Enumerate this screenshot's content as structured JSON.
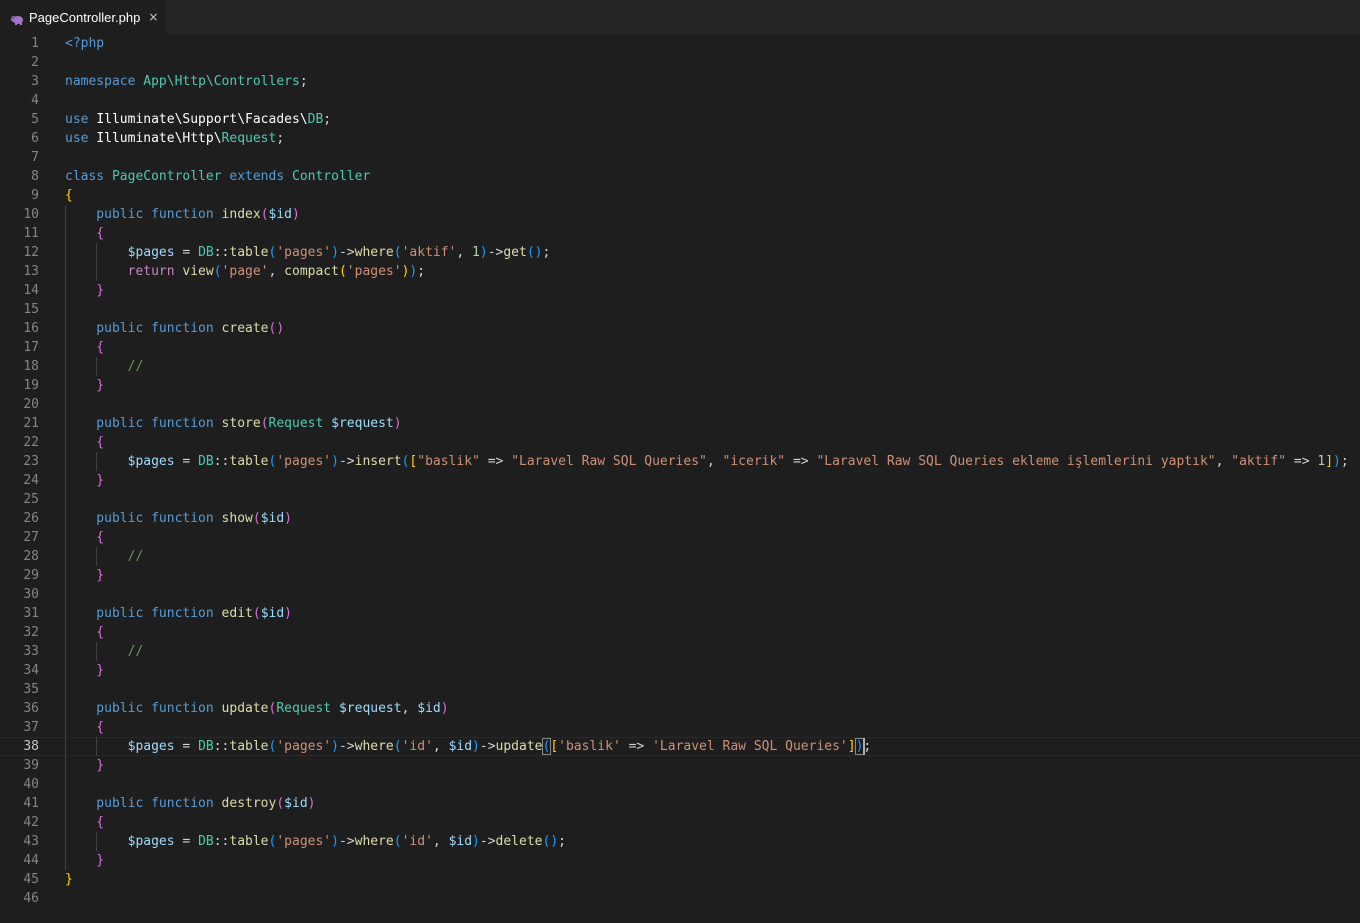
{
  "tab": {
    "title": "PageController.php",
    "close": "×",
    "icon": "php-elephant-icon"
  },
  "editor": {
    "active_line": 38,
    "lines": [
      {
        "n": "1",
        "tokens": [
          {
            "t": "<?php",
            "c": "kw"
          }
        ]
      },
      {
        "n": "2",
        "tokens": []
      },
      {
        "n": "3",
        "tokens": [
          {
            "t": "namespace ",
            "c": "kw"
          },
          {
            "t": "App\\Http\\Controllers",
            "c": "cls"
          },
          {
            "t": ";",
            "c": "txt"
          }
        ]
      },
      {
        "n": "4",
        "tokens": []
      },
      {
        "n": "5",
        "tokens": [
          {
            "t": "use ",
            "c": "kw"
          },
          {
            "t": "Illuminate\\Support\\Facades\\",
            "c": "pl"
          },
          {
            "t": "DB",
            "c": "cls"
          },
          {
            "t": ";",
            "c": "txt"
          }
        ]
      },
      {
        "n": "6",
        "tokens": [
          {
            "t": "use ",
            "c": "kw"
          },
          {
            "t": "Illuminate\\Http\\",
            "c": "pl"
          },
          {
            "t": "Request",
            "c": "cls"
          },
          {
            "t": ";",
            "c": "txt"
          }
        ]
      },
      {
        "n": "7",
        "tokens": []
      },
      {
        "n": "8",
        "tokens": [
          {
            "t": "class ",
            "c": "kw"
          },
          {
            "t": "PageController ",
            "c": "cls"
          },
          {
            "t": "extends ",
            "c": "kw"
          },
          {
            "t": "Controller",
            "c": "cls"
          }
        ]
      },
      {
        "n": "9",
        "tokens": [
          {
            "t": "{",
            "c": "b1"
          }
        ]
      },
      {
        "n": "10",
        "tokens": [
          {
            "t": "    public function ",
            "c": "kw"
          },
          {
            "t": "index",
            "c": "fn"
          },
          {
            "t": "(",
            "c": "b2"
          },
          {
            "t": "$id",
            "c": "var"
          },
          {
            "t": ")",
            "c": "b2"
          }
        ]
      },
      {
        "n": "11",
        "tokens": [
          {
            "t": "    {",
            "c": "b2"
          }
        ]
      },
      {
        "n": "12",
        "tokens": [
          {
            "t": "        $pages",
            "c": "var"
          },
          {
            "t": " = ",
            "c": "txt"
          },
          {
            "t": "DB",
            "c": "cls"
          },
          {
            "t": "::",
            "c": "txt"
          },
          {
            "t": "table",
            "c": "fn"
          },
          {
            "t": "(",
            "c": "b3"
          },
          {
            "t": "'pages'",
            "c": "str"
          },
          {
            "t": ")",
            "c": "b3"
          },
          {
            "t": "->",
            "c": "txt"
          },
          {
            "t": "where",
            "c": "fn"
          },
          {
            "t": "(",
            "c": "b3"
          },
          {
            "t": "'aktif'",
            "c": "str"
          },
          {
            "t": ", ",
            "c": "txt"
          },
          {
            "t": "1",
            "c": "num"
          },
          {
            "t": ")",
            "c": "b3"
          },
          {
            "t": "->",
            "c": "txt"
          },
          {
            "t": "get",
            "c": "fn"
          },
          {
            "t": "()",
            "c": "b3"
          },
          {
            "t": ";",
            "c": "txt"
          }
        ]
      },
      {
        "n": "13",
        "tokens": [
          {
            "t": "        return ",
            "c": "ctrl"
          },
          {
            "t": "view",
            "c": "fn"
          },
          {
            "t": "(",
            "c": "b3"
          },
          {
            "t": "'page'",
            "c": "str"
          },
          {
            "t": ", ",
            "c": "txt"
          },
          {
            "t": "compact",
            "c": "fn"
          },
          {
            "t": "(",
            "c": "b1"
          },
          {
            "t": "'pages'",
            "c": "str"
          },
          {
            "t": ")",
            "c": "b1"
          },
          {
            "t": ")",
            "c": "b3"
          },
          {
            "t": ";",
            "c": "txt"
          }
        ]
      },
      {
        "n": "14",
        "tokens": [
          {
            "t": "    }",
            "c": "b2"
          }
        ]
      },
      {
        "n": "15",
        "tokens": []
      },
      {
        "n": "16",
        "tokens": [
          {
            "t": "    public function ",
            "c": "kw"
          },
          {
            "t": "create",
            "c": "fn"
          },
          {
            "t": "()",
            "c": "b2"
          }
        ]
      },
      {
        "n": "17",
        "tokens": [
          {
            "t": "    {",
            "c": "b2"
          }
        ]
      },
      {
        "n": "18",
        "tokens": [
          {
            "t": "        //",
            "c": "cmt"
          }
        ]
      },
      {
        "n": "19",
        "tokens": [
          {
            "t": "    }",
            "c": "b2"
          }
        ]
      },
      {
        "n": "20",
        "tokens": []
      },
      {
        "n": "21",
        "tokens": [
          {
            "t": "    public function ",
            "c": "kw"
          },
          {
            "t": "store",
            "c": "fn"
          },
          {
            "t": "(",
            "c": "b2"
          },
          {
            "t": "Request ",
            "c": "cls"
          },
          {
            "t": "$request",
            "c": "var"
          },
          {
            "t": ")",
            "c": "b2"
          }
        ]
      },
      {
        "n": "22",
        "tokens": [
          {
            "t": "    {",
            "c": "b2"
          }
        ]
      },
      {
        "n": "23",
        "tokens": [
          {
            "t": "        $pages",
            "c": "var"
          },
          {
            "t": " = ",
            "c": "txt"
          },
          {
            "t": "DB",
            "c": "cls"
          },
          {
            "t": "::",
            "c": "txt"
          },
          {
            "t": "table",
            "c": "fn"
          },
          {
            "t": "(",
            "c": "b3"
          },
          {
            "t": "'pages'",
            "c": "str"
          },
          {
            "t": ")",
            "c": "b3"
          },
          {
            "t": "->",
            "c": "txt"
          },
          {
            "t": "insert",
            "c": "fn"
          },
          {
            "t": "(",
            "c": "b3"
          },
          {
            "t": "[",
            "c": "b1"
          },
          {
            "t": "\"baslik\"",
            "c": "str"
          },
          {
            "t": " => ",
            "c": "txt"
          },
          {
            "t": "\"Laravel Raw SQL Queries\"",
            "c": "str"
          },
          {
            "t": ", ",
            "c": "txt"
          },
          {
            "t": "\"icerik\"",
            "c": "str"
          },
          {
            "t": " => ",
            "c": "txt"
          },
          {
            "t": "\"Laravel Raw SQL Queries ekleme işlemlerini yaptık\"",
            "c": "str"
          },
          {
            "t": ", ",
            "c": "txt"
          },
          {
            "t": "\"aktif\"",
            "c": "str"
          },
          {
            "t": " => ",
            "c": "txt"
          },
          {
            "t": "1",
            "c": "num"
          },
          {
            "t": "]",
            "c": "b1"
          },
          {
            "t": ")",
            "c": "b3"
          },
          {
            "t": ";",
            "c": "txt"
          }
        ]
      },
      {
        "n": "24",
        "tokens": [
          {
            "t": "    }",
            "c": "b2"
          }
        ]
      },
      {
        "n": "25",
        "tokens": []
      },
      {
        "n": "26",
        "tokens": [
          {
            "t": "    public function ",
            "c": "kw"
          },
          {
            "t": "show",
            "c": "fn"
          },
          {
            "t": "(",
            "c": "b2"
          },
          {
            "t": "$id",
            "c": "var"
          },
          {
            "t": ")",
            "c": "b2"
          }
        ]
      },
      {
        "n": "27",
        "tokens": [
          {
            "t": "    {",
            "c": "b2"
          }
        ]
      },
      {
        "n": "28",
        "tokens": [
          {
            "t": "        //",
            "c": "cmt"
          }
        ]
      },
      {
        "n": "29",
        "tokens": [
          {
            "t": "    }",
            "c": "b2"
          }
        ]
      },
      {
        "n": "30",
        "tokens": []
      },
      {
        "n": "31",
        "tokens": [
          {
            "t": "    public function ",
            "c": "kw"
          },
          {
            "t": "edit",
            "c": "fn"
          },
          {
            "t": "(",
            "c": "b2"
          },
          {
            "t": "$id",
            "c": "var"
          },
          {
            "t": ")",
            "c": "b2"
          }
        ]
      },
      {
        "n": "32",
        "tokens": [
          {
            "t": "    {",
            "c": "b2"
          }
        ]
      },
      {
        "n": "33",
        "tokens": [
          {
            "t": "        //",
            "c": "cmt"
          }
        ]
      },
      {
        "n": "34",
        "tokens": [
          {
            "t": "    }",
            "c": "b2"
          }
        ]
      },
      {
        "n": "35",
        "tokens": []
      },
      {
        "n": "36",
        "tokens": [
          {
            "t": "    public function ",
            "c": "kw"
          },
          {
            "t": "update",
            "c": "fn"
          },
          {
            "t": "(",
            "c": "b2"
          },
          {
            "t": "Request ",
            "c": "cls"
          },
          {
            "t": "$request",
            "c": "var"
          },
          {
            "t": ", ",
            "c": "txt"
          },
          {
            "t": "$id",
            "c": "var"
          },
          {
            "t": ")",
            "c": "b2"
          }
        ]
      },
      {
        "n": "37",
        "tokens": [
          {
            "t": "    {",
            "c": "b2"
          }
        ]
      },
      {
        "n": "38",
        "tokens": [
          {
            "t": "        $pages",
            "c": "var"
          },
          {
            "t": " = ",
            "c": "txt"
          },
          {
            "t": "DB",
            "c": "cls"
          },
          {
            "t": "::",
            "c": "txt"
          },
          {
            "t": "table",
            "c": "fn"
          },
          {
            "t": "(",
            "c": "b3"
          },
          {
            "t": "'pages'",
            "c": "str"
          },
          {
            "t": ")",
            "c": "b3"
          },
          {
            "t": "->",
            "c": "txt"
          },
          {
            "t": "where",
            "c": "fn"
          },
          {
            "t": "(",
            "c": "b3"
          },
          {
            "t": "'id'",
            "c": "str"
          },
          {
            "t": ", ",
            "c": "txt"
          },
          {
            "t": "$id",
            "c": "var"
          },
          {
            "t": ")",
            "c": "b3"
          },
          {
            "t": "->",
            "c": "txt"
          },
          {
            "t": "update",
            "c": "fn"
          },
          {
            "t": "(",
            "c": "b3 brk"
          },
          {
            "t": "[",
            "c": "b1"
          },
          {
            "t": "'baslik'",
            "c": "str"
          },
          {
            "t": " => ",
            "c": "txt"
          },
          {
            "t": "'Laravel Raw SQL Queries'",
            "c": "str"
          },
          {
            "t": "]",
            "c": "b1"
          },
          {
            "t": ")",
            "c": "b3 brk"
          },
          {
            "t": ";",
            "c": "txt"
          }
        ]
      },
      {
        "n": "39",
        "tokens": [
          {
            "t": "    }",
            "c": "b2"
          }
        ]
      },
      {
        "n": "40",
        "tokens": []
      },
      {
        "n": "41",
        "tokens": [
          {
            "t": "    public function ",
            "c": "kw"
          },
          {
            "t": "destroy",
            "c": "fn"
          },
          {
            "t": "(",
            "c": "b2"
          },
          {
            "t": "$id",
            "c": "var"
          },
          {
            "t": ")",
            "c": "b2"
          }
        ]
      },
      {
        "n": "42",
        "tokens": [
          {
            "t": "    {",
            "c": "b2"
          }
        ]
      },
      {
        "n": "43",
        "tokens": [
          {
            "t": "        $pages",
            "c": "var"
          },
          {
            "t": " = ",
            "c": "txt"
          },
          {
            "t": "DB",
            "c": "cls"
          },
          {
            "t": "::",
            "c": "txt"
          },
          {
            "t": "table",
            "c": "fn"
          },
          {
            "t": "(",
            "c": "b3"
          },
          {
            "t": "'pages'",
            "c": "str"
          },
          {
            "t": ")",
            "c": "b3"
          },
          {
            "t": "->",
            "c": "txt"
          },
          {
            "t": "where",
            "c": "fn"
          },
          {
            "t": "(",
            "c": "b3"
          },
          {
            "t": "'id'",
            "c": "str"
          },
          {
            "t": ", ",
            "c": "txt"
          },
          {
            "t": "$id",
            "c": "var"
          },
          {
            "t": ")",
            "c": "b3"
          },
          {
            "t": "->",
            "c": "txt"
          },
          {
            "t": "delete",
            "c": "fn"
          },
          {
            "t": "()",
            "c": "b3"
          },
          {
            "t": ";",
            "c": "txt"
          }
        ]
      },
      {
        "n": "44",
        "tokens": [
          {
            "t": "    }",
            "c": "b2"
          }
        ]
      },
      {
        "n": "45",
        "tokens": [
          {
            "t": "}",
            "c": "b1"
          }
        ]
      },
      {
        "n": "46",
        "tokens": []
      }
    ]
  }
}
